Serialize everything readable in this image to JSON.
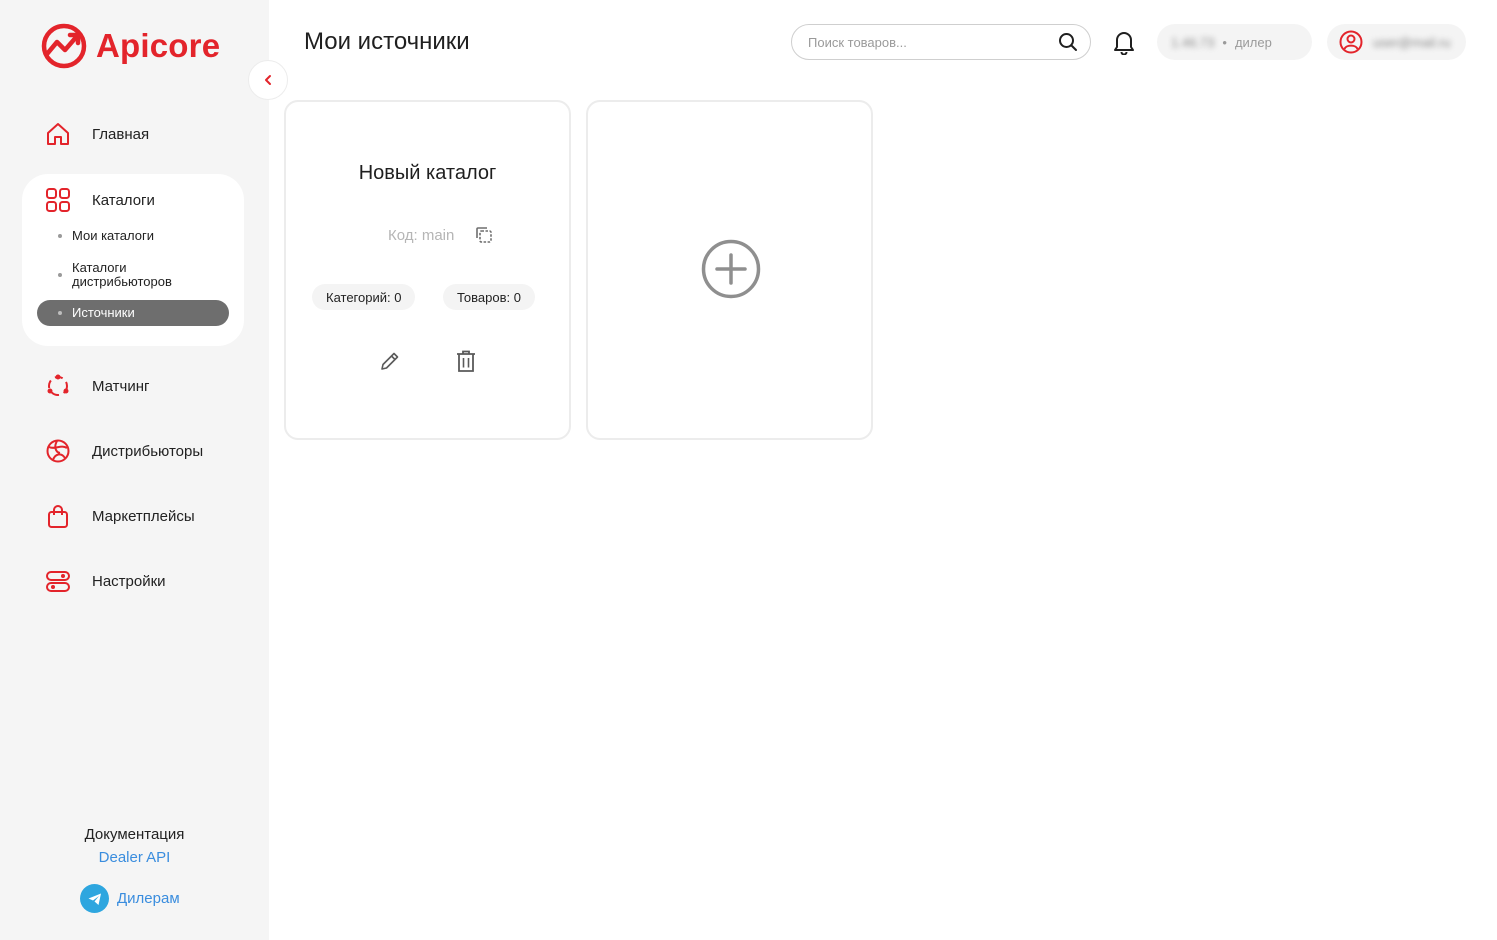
{
  "app": {
    "logo_text": "Apicore",
    "brand_color": "#e3242b"
  },
  "sidebar": {
    "items": [
      {
        "label": "Главная",
        "icon": "home-icon"
      },
      {
        "label": "Каталоги",
        "icon": "grid-icon"
      },
      {
        "label": "Матчинг",
        "icon": "matching-icon"
      },
      {
        "label": "Дистрибьюторы",
        "icon": "globe-icon"
      },
      {
        "label": "Маркетплейсы",
        "icon": "bag-icon"
      },
      {
        "label": "Настройки",
        "icon": "settings-toggle-icon"
      }
    ],
    "catalog_subitems": [
      {
        "label": "Мои каталоги",
        "active": false
      },
      {
        "label": "Каталоги дистрибьюторов",
        "active": false
      },
      {
        "label": "Источники",
        "active": true
      }
    ],
    "docs_title": "Документация",
    "docs_link": "Dealer API",
    "telegram_label": "Дилерам"
  },
  "header": {
    "title": "Мои источники",
    "search_placeholder": "Поиск товаров...",
    "dealer_id": "1.46.73",
    "dealer_role": "дилер",
    "user_name": "user@mail.ru"
  },
  "cards": [
    {
      "name": "Новый каталог",
      "code_label": "Код: main",
      "categories_label": "Категорий: 0",
      "products_label": "Товаров: 0"
    }
  ]
}
